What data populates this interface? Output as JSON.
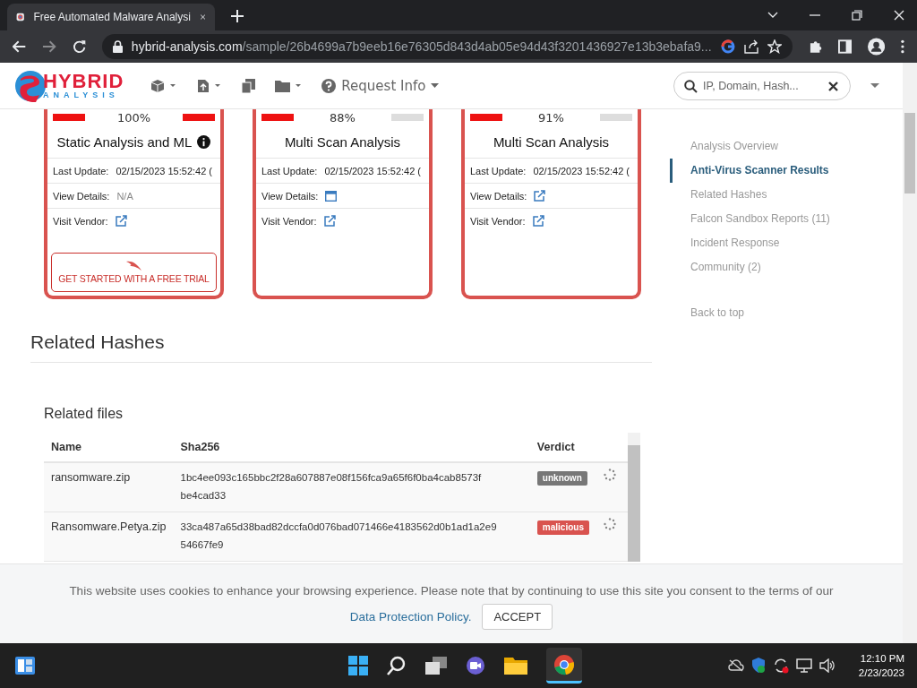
{
  "browser": {
    "tab_title": "Free Automated Malware Analysi",
    "url_host": "hybrid-analysis.com",
    "url_path": "/sample/26b4699a7b9eeb16e76305d843d4ab05e94d43f3201436927e13b3ebafa9..."
  },
  "header": {
    "logo_top": "HYBRID",
    "logo_bottom": "ANALYSIS",
    "request_info": "Request Info",
    "search": {
      "placeholder": "IP, Domain, Hash..."
    }
  },
  "cards": [
    {
      "percent": "100%",
      "color": "#ee1111",
      "title": "Static Analysis and ML",
      "has_info": true,
      "rows": [
        {
          "label": "Last Update:",
          "kind": "text",
          "value": "02/15/2023 15:52:42 ("
        },
        {
          "label": "View Details:",
          "kind": "muted",
          "value": "N/A"
        },
        {
          "label": "Visit Vendor:",
          "kind": "link"
        }
      ],
      "trial_button": "GET STARTED WITH A FREE TRIAL"
    },
    {
      "percent": "88%",
      "color": "#dddddd",
      "title": "Multi Scan Analysis",
      "has_info": false,
      "rows": [
        {
          "label": "Last Update:",
          "kind": "text",
          "value": "02/15/2023 15:52:42 ("
        },
        {
          "label": "View Details:",
          "kind": "window"
        },
        {
          "label": "Visit Vendor:",
          "kind": "link"
        }
      ]
    },
    {
      "percent": "91%",
      "color": "#dddddd",
      "title": "Multi Scan Analysis",
      "has_info": false,
      "rows": [
        {
          "label": "Last Update:",
          "kind": "text",
          "value": "02/15/2023 15:52:42 ("
        },
        {
          "label": "View Details:",
          "kind": "link"
        },
        {
          "label": "Visit Vendor:",
          "kind": "link"
        }
      ]
    }
  ],
  "sidebar": {
    "items": [
      {
        "label": "Analysis Overview",
        "selected": false
      },
      {
        "label": "Anti-Virus Scanner Results",
        "selected": true
      },
      {
        "label": "Related Hashes",
        "selected": false
      },
      {
        "label": "Falcon Sandbox Reports (11)",
        "selected": false
      },
      {
        "label": "Incident Response",
        "selected": false
      },
      {
        "label": "Community (2)",
        "selected": false
      }
    ],
    "back_to_top": "Back to top"
  },
  "related": {
    "heading": "Related Hashes",
    "subheading": "Related files",
    "columns": [
      "Name",
      "Sha256",
      "Verdict"
    ],
    "rows": [
      {
        "name": "ransomware.zip",
        "sha256": "1bc4ee093c165bbc2f28a607887e08f156fca9a65f6f0ba4cab8573fbe4cad33",
        "verdict": "unknown",
        "color": "#777777"
      },
      {
        "name": "Ransomware.Petya.zip",
        "sha256": "33ca487a65d38bad82dccfa0d076bad071466e4183562d0b1ad1a2e954667fe9",
        "verdict": "malicious",
        "color": "#d9534f"
      }
    ]
  },
  "cookie": {
    "text": "This website uses cookies to enhance your browsing experience. Please note that by continuing to use this site you consent to the terms of our",
    "link": "Data Protection Policy.",
    "accept": "ACCEPT"
  },
  "taskbar": {
    "time": "12:10 PM",
    "date": "2/23/2023"
  }
}
